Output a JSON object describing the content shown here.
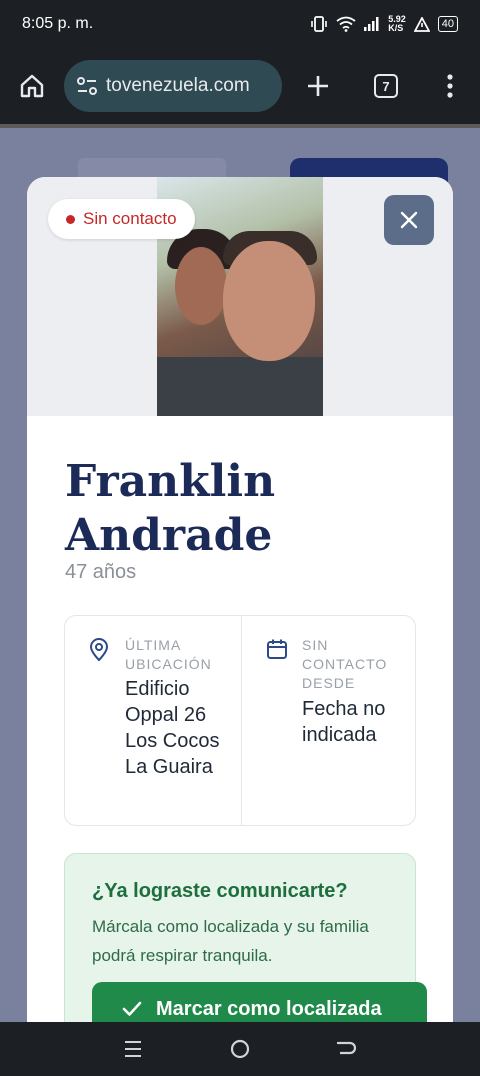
{
  "status_bar": {
    "time": "8:05 p. m.",
    "net_speed_top": "5.92",
    "net_speed_unit": "K/S",
    "battery": "40"
  },
  "browser": {
    "url": "tovenezuela.com",
    "tab_count": "7"
  },
  "modal": {
    "status_badge": "Sin contacto",
    "status_color": "#c62828",
    "name": "Franklin Andrade",
    "age": "47 años",
    "last_location": {
      "label": "ÚLTIMA UBICACIÓN",
      "value": "Edificio Oppal 26 Los Cocos La Guaira"
    },
    "no_contact_since": {
      "label": "SIN CONTACTO DESDE",
      "value": "Fecha no indicada"
    },
    "cta": {
      "title": "¿Ya lograste comunicarte?",
      "text": "Márcala como localizada y su familia podrá respirar tranquila.",
      "button_label": "Marcar como localizada",
      "button_color": "#1f8a4a"
    },
    "name_color": "#1b2a57"
  }
}
